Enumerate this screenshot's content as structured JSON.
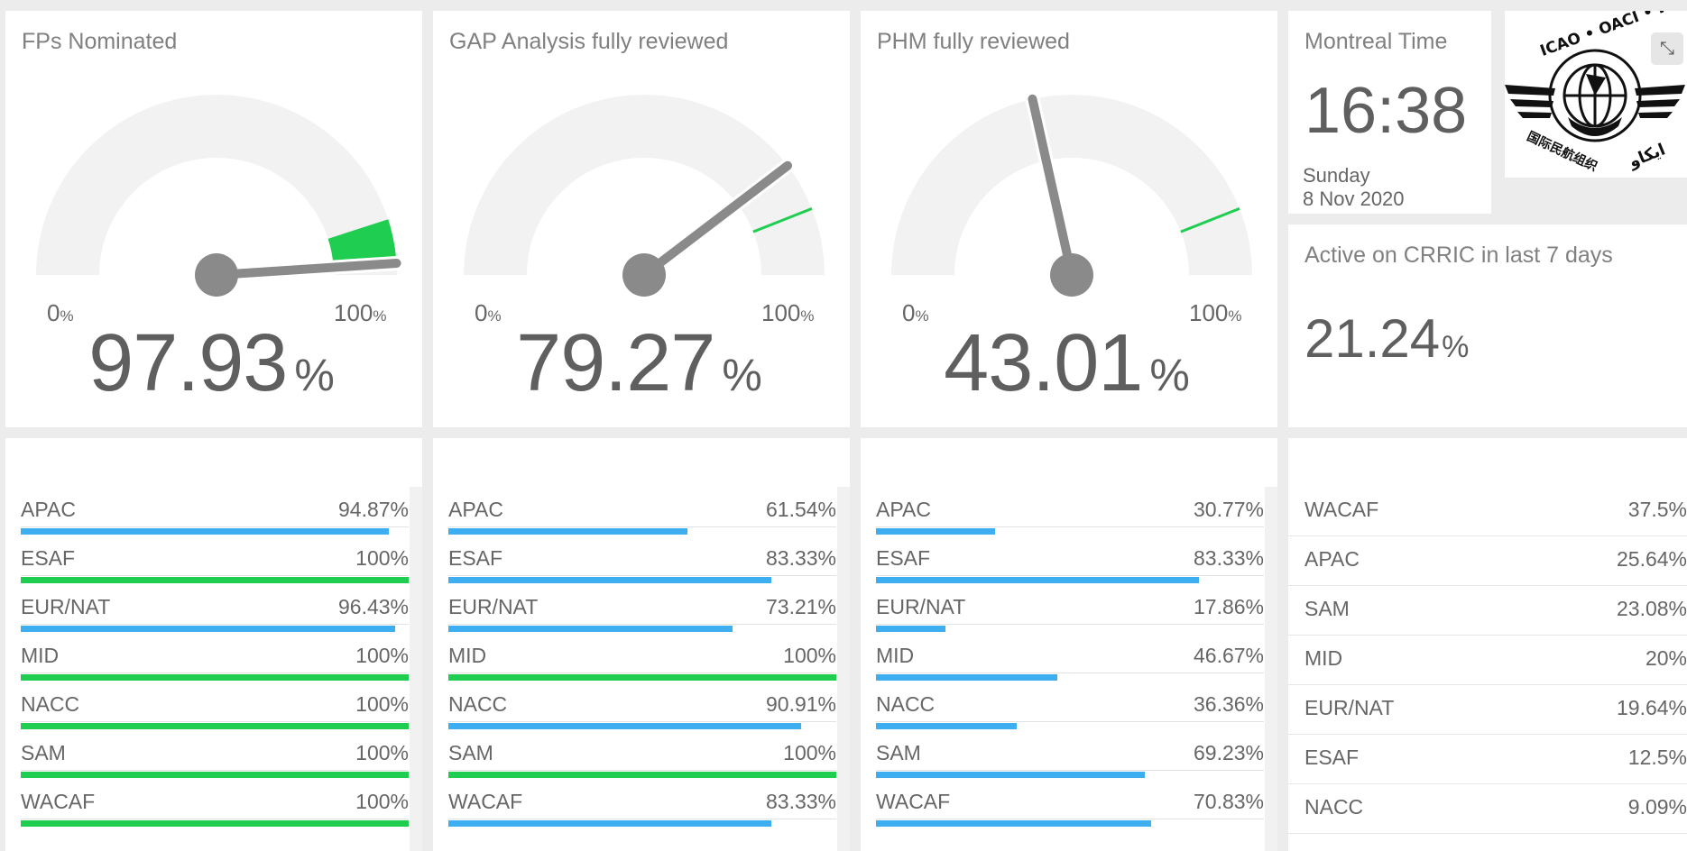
{
  "colors": {
    "green": "#1fce50",
    "blue": "#3daef0",
    "needle": "#8a8a8a",
    "arc": "#f2f2f2"
  },
  "gauges": [
    {
      "title": "FPs Nominated",
      "min_label": "0",
      "max_label": "100",
      "unit": "%",
      "value": "97.93",
      "value_num": 97.93,
      "target_pct": 90
    },
    {
      "title": "GAP Analysis fully reviewed",
      "min_label": "0",
      "max_label": "100",
      "unit": "%",
      "value": "79.27",
      "value_num": 79.27,
      "target_pct": 88
    },
    {
      "title": "PHM fully reviewed",
      "min_label": "0",
      "max_label": "100",
      "unit": "%",
      "value": "43.01",
      "value_num": 43.01,
      "target_pct": 88
    }
  ],
  "clock": {
    "title": "Montreal Time",
    "time": "16:38",
    "day": "Sunday",
    "date": "8 Nov 2020"
  },
  "logo": {
    "icon": "icao-logo",
    "text": "ICAO • OACI • ИКАО",
    "text_cn": "国际民航组织",
    "text_ar": "ايكاو"
  },
  "expand_icon": "collapse-icon",
  "active": {
    "title": "Active on CRRIC in last 7 days",
    "value": "21.24",
    "unit": "%"
  },
  "regional": [
    {
      "panel": "fps-nominated",
      "rows": [
        {
          "name": "APAC",
          "value": "94.87%",
          "pct": 94.87
        },
        {
          "name": "ESAF",
          "value": "100%",
          "pct": 100
        },
        {
          "name": "EUR/NAT",
          "value": "96.43%",
          "pct": 96.43
        },
        {
          "name": "MID",
          "value": "100%",
          "pct": 100
        },
        {
          "name": "NACC",
          "value": "100%",
          "pct": 100
        },
        {
          "name": "SAM",
          "value": "100%",
          "pct": 100
        },
        {
          "name": "WACAF",
          "value": "100%",
          "pct": 100
        }
      ]
    },
    {
      "panel": "gap-analysis",
      "rows": [
        {
          "name": "APAC",
          "value": "61.54%",
          "pct": 61.54
        },
        {
          "name": "ESAF",
          "value": "83.33%",
          "pct": 83.33
        },
        {
          "name": "EUR/NAT",
          "value": "73.21%",
          "pct": 73.21
        },
        {
          "name": "MID",
          "value": "100%",
          "pct": 100
        },
        {
          "name": "NACC",
          "value": "90.91%",
          "pct": 90.91
        },
        {
          "name": "SAM",
          "value": "100%",
          "pct": 100
        },
        {
          "name": "WACAF",
          "value": "83.33%",
          "pct": 83.33
        }
      ]
    },
    {
      "panel": "phm-reviewed",
      "rows": [
        {
          "name": "APAC",
          "value": "30.77%",
          "pct": 30.77
        },
        {
          "name": "ESAF",
          "value": "83.33%",
          "pct": 83.33
        },
        {
          "name": "EUR/NAT",
          "value": "17.86%",
          "pct": 17.86
        },
        {
          "name": "MID",
          "value": "46.67%",
          "pct": 46.67
        },
        {
          "name": "NACC",
          "value": "36.36%",
          "pct": 36.36
        },
        {
          "name": "SAM",
          "value": "69.23%",
          "pct": 69.23
        },
        {
          "name": "WACAF",
          "value": "70.83%",
          "pct": 70.83
        }
      ]
    }
  ],
  "active_regions": [
    {
      "name": "WACAF",
      "value": "37.5%"
    },
    {
      "name": "APAC",
      "value": "25.64%"
    },
    {
      "name": "SAM",
      "value": "23.08%"
    },
    {
      "name": "MID",
      "value": "20%"
    },
    {
      "name": "EUR/NAT",
      "value": "19.64%"
    },
    {
      "name": "ESAF",
      "value": "12.5%"
    },
    {
      "name": "NACC",
      "value": "9.09%"
    }
  ]
}
